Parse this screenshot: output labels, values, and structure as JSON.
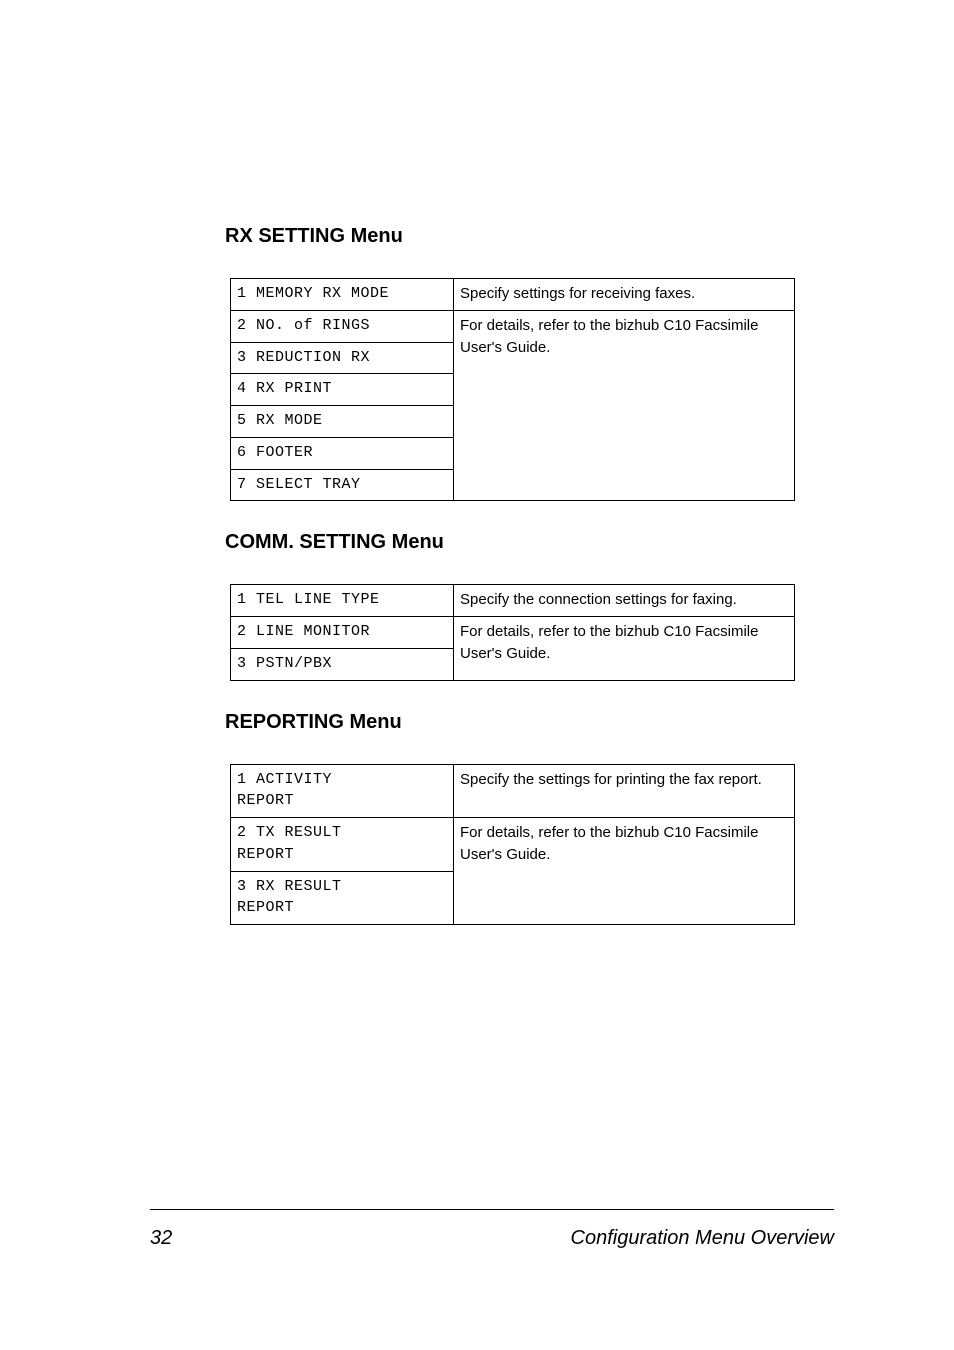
{
  "sections": {
    "rx": {
      "title": "RX SETTING Menu",
      "rows": [
        "1 MEMORY RX MODE",
        "2 NO. of RINGS",
        "3 REDUCTION RX",
        "4 RX PRINT",
        "5 RX MODE",
        "6 FOOTER",
        "7 SELECT TRAY"
      ],
      "desc_line1": "Specify settings for receiving faxes.",
      "desc_line2": "For details, refer to the bizhub C10 Facsimile User's Guide."
    },
    "comm": {
      "title": "COMM. SETTING Menu",
      "rows": [
        "1 TEL LINE TYPE",
        "2 LINE MONITOR",
        "3 PSTN/PBX"
      ],
      "desc_line1": "Specify the connection settings for faxing.",
      "desc_line2": "For details, refer to the bizhub C10 Facsimile User's Guide."
    },
    "reporting": {
      "title": "REPORTING Menu",
      "rows": [
        "1 ACTIVITY\nREPORT",
        "2 TX RESULT\nREPORT",
        "3 RX RESULT\nREPORT"
      ],
      "desc_line1": "Specify the settings for printing the fax report.",
      "desc_line2": "For details, refer to the bizhub C10 Facsimile User's Guide."
    }
  },
  "footer": {
    "page_number": "32",
    "title": "Configuration Menu Overview"
  }
}
